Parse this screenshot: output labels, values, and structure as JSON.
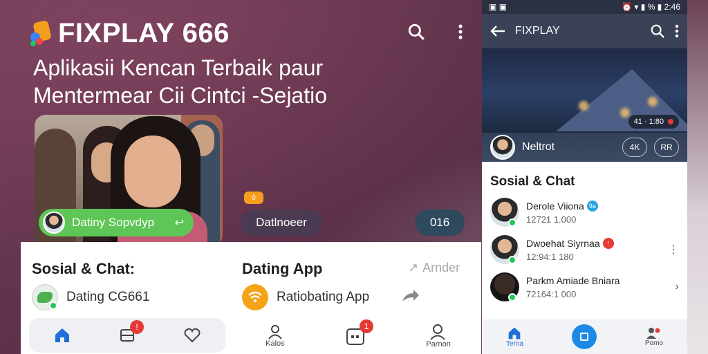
{
  "brand": {
    "name": "FIXPLAY 666"
  },
  "headline": {
    "line1": "Aplikasii Kencan Terbaik paur",
    "line2": "Mentermear Cii Cintci -Sejatio"
  },
  "promo": {
    "green_pill": "Datiny Sopvdyp",
    "green_pill_arrow": "↩",
    "orange_chip": "ô",
    "dark_pill": "Datlnoeer",
    "teal_pill": "016"
  },
  "panel": {
    "left_section": {
      "title": "Sosial & Chat:",
      "item": "Dating CG661"
    },
    "right_section": {
      "title": "Dating App",
      "action": "Arnder",
      "item": "Ratiobating App"
    }
  },
  "nav_left": {
    "badge": "!"
  },
  "nav_right": {
    "items": [
      {
        "label": "Kalos"
      },
      {
        "label": ""
      },
      {
        "label": "Parnon"
      }
    ],
    "badge": "1"
  },
  "phone": {
    "status": {
      "time": "2:46",
      "battery": "%"
    },
    "appbar_title": "FIXPLAY",
    "hero": {
      "counter": "41 · 1:80",
      "user_name": "Neltrot",
      "chip1": "4K",
      "chip2": "RR"
    },
    "section_title": "Sosial & Chat",
    "chats": [
      {
        "name": "Derole Viiona",
        "sub": "12721 1.000",
        "badge": "9a",
        "badge_color": "#29a3e0"
      },
      {
        "name": "Dwoehat Siyrnaa",
        "sub": "12:94:1 180",
        "badge": "!",
        "badge_color": "#e53935"
      },
      {
        "name": "Parkm Amiade Bniara",
        "sub": "72164:1 000",
        "badge": "",
        "badge_color": ""
      }
    ],
    "bottom": {
      "left": "Terna",
      "right": "Pomo"
    }
  },
  "colors": {
    "accent_green": "#5ec656",
    "accent_orange": "#f59d1e",
    "badge_red": "#e53935",
    "brand_blue": "#1e88e5"
  }
}
